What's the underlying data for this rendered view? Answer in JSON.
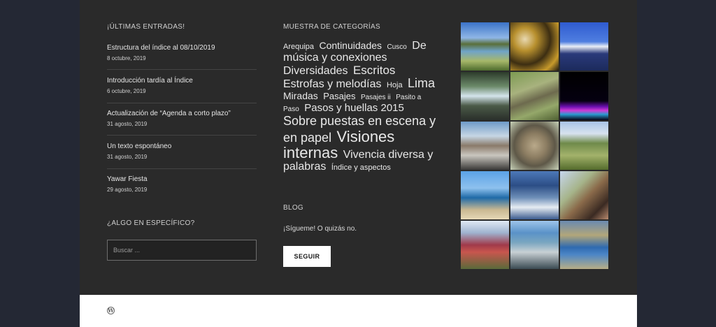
{
  "recent": {
    "title": "¡ÚLTIMAS ENTRADAS!",
    "posts": [
      {
        "title": "Estructura del índice al 08/10/2019",
        "date": "8 octubre, 2019"
      },
      {
        "title": "Introducción tardía al Índice",
        "date": "6 octubre, 2019"
      },
      {
        "title": "Actualización de “Agenda a corto plazo”",
        "date": "31 agosto, 2019"
      },
      {
        "title": "Un texto espontáneo",
        "date": "31 agosto, 2019"
      },
      {
        "title": "Yawar Fiesta",
        "date": "29 agosto, 2019"
      }
    ]
  },
  "search": {
    "title": "¿ALGO EN ESPECÍFICO?",
    "placeholder": "Buscar ..."
  },
  "categories": {
    "title": "MUESTRA DE CATEGORÍAS",
    "tags": [
      {
        "label": "Arequipa"
      },
      {
        "label": "Continuidades"
      },
      {
        "label": "Cusco"
      },
      {
        "label": "De música y conexiones"
      },
      {
        "label": "Diversidades"
      },
      {
        "label": "Escritos"
      },
      {
        "label": "Estrofas y melodías"
      },
      {
        "label": "Hoja"
      },
      {
        "label": "Lima"
      },
      {
        "label": "Miradas"
      },
      {
        "label": "Pasajes"
      },
      {
        "label": "Pasajes ii"
      },
      {
        "label": "Pasito a Paso"
      },
      {
        "label": "Pasos y huellas 2015"
      },
      {
        "label": "Sobre puestas en escena y en papel"
      },
      {
        "label": "Visiones internas"
      },
      {
        "label": "Vivencia diversa y palabras"
      },
      {
        "label": "Índice y aspectos"
      }
    ]
  },
  "blog": {
    "title": "BLOG",
    "text": "¡Sígueme! O quizás no.",
    "button": "SEGUIR"
  },
  "gallery": {
    "photos": [
      {
        "name": "lake-landscape"
      },
      {
        "name": "autumn-leaves"
      },
      {
        "name": "snowy-mountain"
      },
      {
        "name": "waterfall"
      },
      {
        "name": "stone-ruins"
      },
      {
        "name": "night-lights"
      },
      {
        "name": "desert-mountains"
      },
      {
        "name": "owl"
      },
      {
        "name": "green-valley"
      },
      {
        "name": "beach-shore"
      },
      {
        "name": "coastal-waves"
      },
      {
        "name": "selfie-man"
      },
      {
        "name": "red-hills"
      },
      {
        "name": "coastal-city"
      },
      {
        "name": "mountain-lake"
      }
    ]
  },
  "footer": {
    "icon": "wordpress-icon"
  }
}
